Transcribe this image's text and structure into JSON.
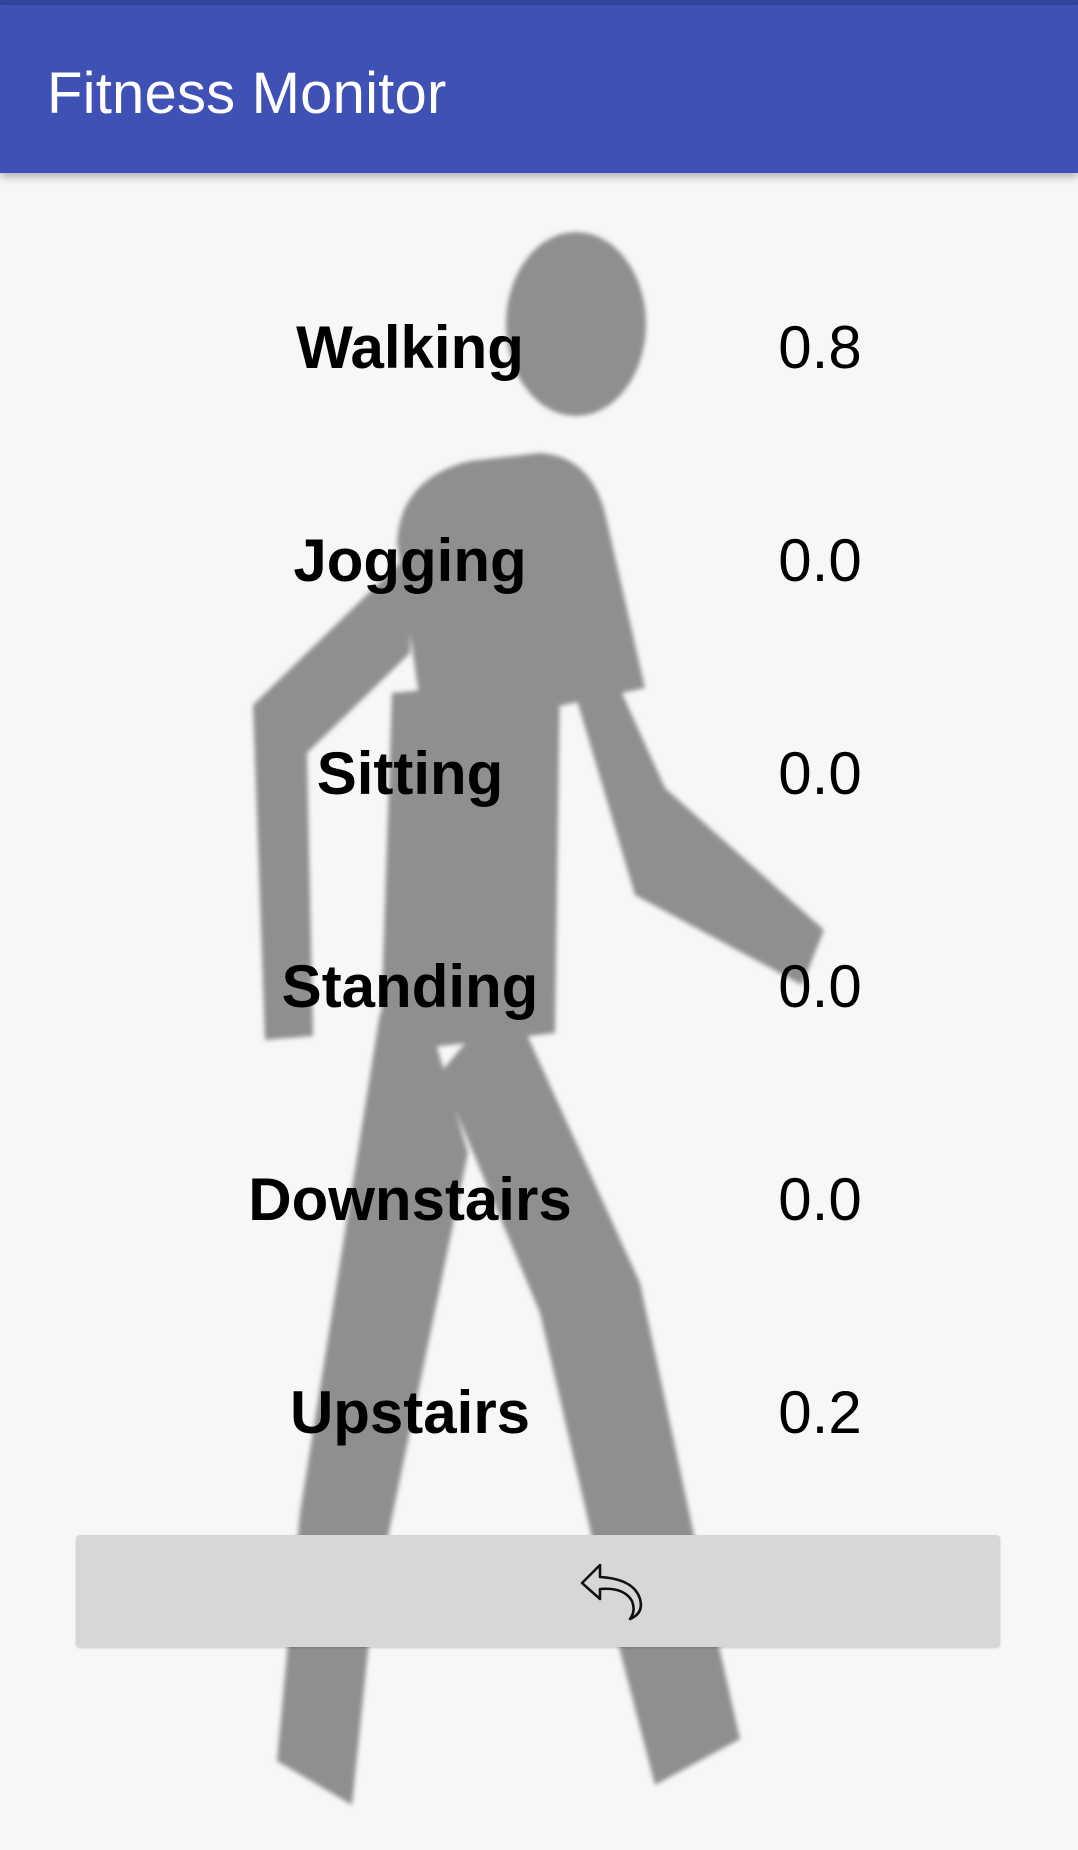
{
  "app_bar": {
    "title": "Fitness Monitor",
    "color": "#3f51b5"
  },
  "activities": [
    {
      "label": "Walking",
      "value": "0.8"
    },
    {
      "label": "Jogging",
      "value": "0.0"
    },
    {
      "label": "Sitting",
      "value": "0.0"
    },
    {
      "label": "Standing",
      "value": "0.0"
    },
    {
      "label": "Downstairs",
      "value": "0.0"
    },
    {
      "label": "Upstairs",
      "value": "0.2"
    }
  ],
  "background_image": {
    "icon": "walking-person-silhouette",
    "color": "#8f8f8f"
  },
  "back_button": {
    "icon": "undo-arrow-icon",
    "color": "#d6d7d7"
  }
}
